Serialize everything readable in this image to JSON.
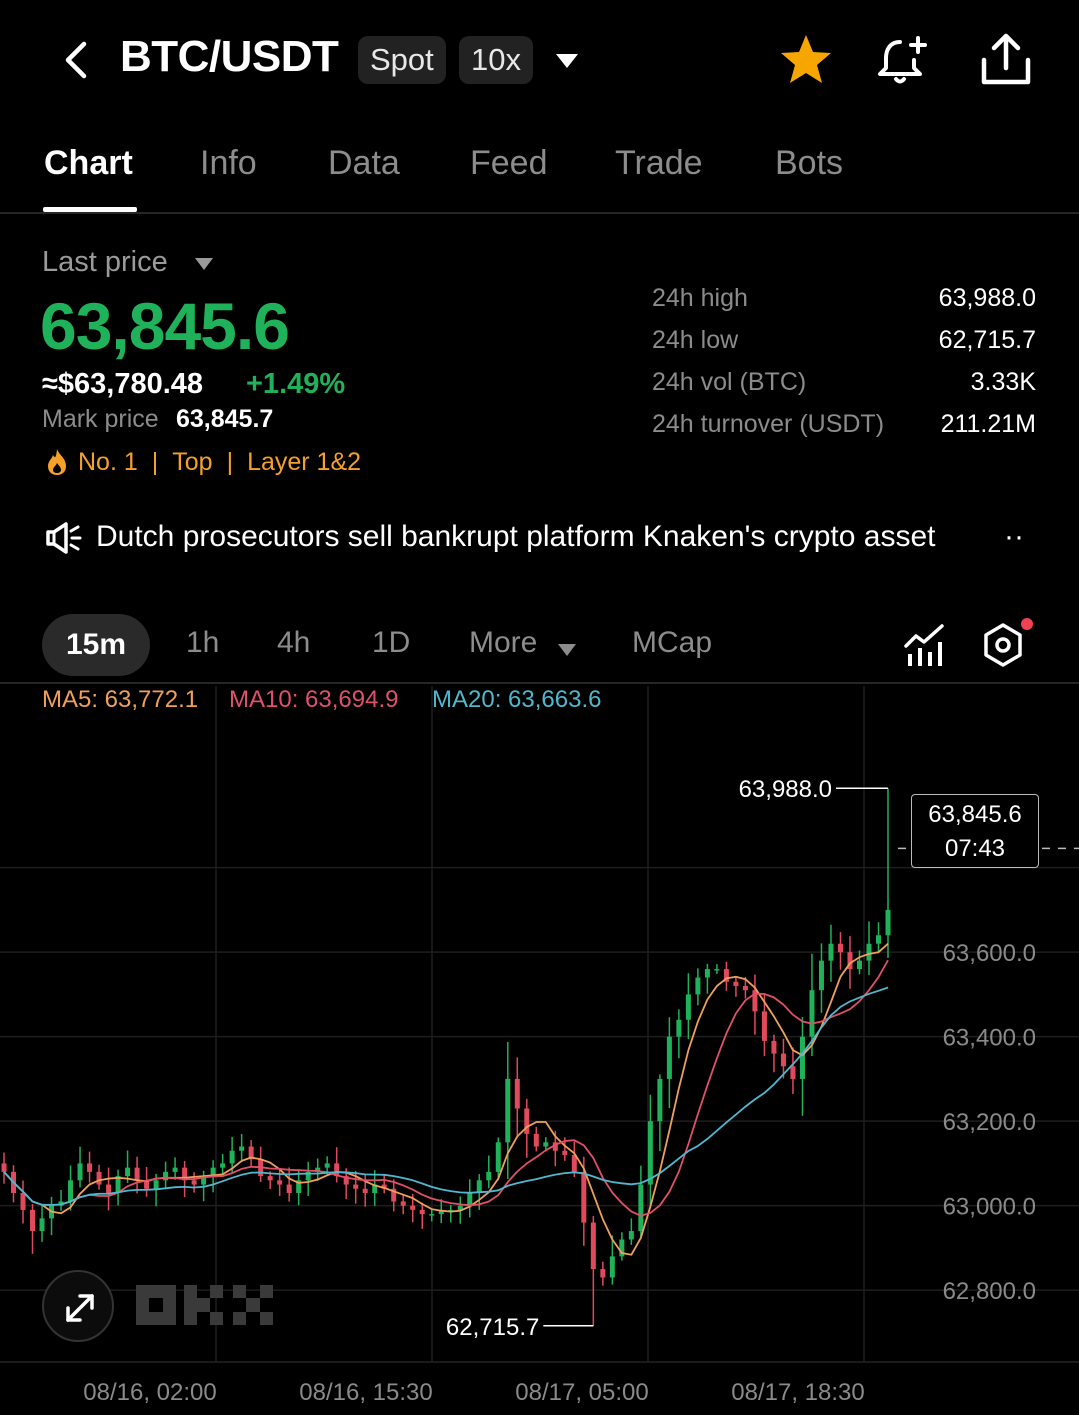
{
  "header": {
    "pair": "BTC/USDT",
    "market_chip": "Spot",
    "leverage_chip": "10x",
    "icons": [
      "back-arrow-icon",
      "chevron-down-icon",
      "star-icon",
      "bell-plus-icon",
      "share-icon"
    ]
  },
  "tabs": [
    "Chart",
    "Info",
    "Data",
    "Feed",
    "Trade",
    "Bots"
  ],
  "active_tab": "Chart",
  "price": {
    "label": "Last price",
    "last": "63,845.6",
    "usd_equiv": "≈$63,780.48",
    "change": "+1.49%",
    "mark_label": "Mark price",
    "mark_value": "63,845.7",
    "tags": [
      "No. 1",
      "Top",
      "Layer 1&2"
    ],
    "up_color": "#1fb25a",
    "tag_color": "#f5a02a"
  },
  "stats": [
    {
      "label": "24h high",
      "value": "63,988.0"
    },
    {
      "label": "24h low",
      "value": "62,715.7"
    },
    {
      "label": "24h vol (BTC)",
      "value": "3.33K"
    },
    {
      "label": "24h turnover (USDT)",
      "value": "211.21M"
    }
  ],
  "news": {
    "text": "Dutch prosecutors sell bankrupt platform Knaken's crypto asset",
    "more": "··"
  },
  "intervals": {
    "items": [
      "15m",
      "1h",
      "4h",
      "1D",
      "More",
      "MCap"
    ],
    "active": "15m"
  },
  "ma": {
    "ma5": "MA5: 63,772.1",
    "ma10": "MA10: 63,694.9",
    "ma20": "MA20: 63,663.6",
    "ma5_color": "#f0a05a",
    "ma10_color": "#e0506a",
    "ma20_color": "#4fb8cf"
  },
  "chart_data": {
    "type": "candlestick",
    "interval": "15m",
    "y_ticks": [
      63600.0,
      63400.0,
      63200.0,
      63000.0,
      62800.0
    ],
    "y_tick_labels": [
      "63,600.0",
      "63,400.0",
      "63,200.0",
      "63,000.0",
      "62,800.0"
    ],
    "x_tick_labels": [
      "08/16, 02:00",
      "08/16, 15:30",
      "08/17, 05:00",
      "08/17, 18:30"
    ],
    "ylim": [
      62630,
      64230
    ],
    "high_marker": {
      "label": "63,988.0",
      "value": 63988.0
    },
    "low_marker": {
      "label": "62,715.7",
      "value": 62715.7
    },
    "last_price": {
      "label": "63,845.6",
      "value": 63845.6,
      "countdown": "07:43",
      "ghost": "63,800.0"
    },
    "close_path": [
      63080,
      63030,
      62990,
      62940,
      62970,
      63000,
      63010,
      63060,
      63100,
      63080,
      63050,
      63030,
      63070,
      63090,
      63060,
      63040,
      63060,
      63080,
      63090,
      63060,
      63050,
      63070,
      63090,
      63100,
      63130,
      63140,
      63110,
      63070,
      63060,
      63050,
      63030,
      63060,
      63080,
      63090,
      63100,
      63070,
      63050,
      63040,
      63030,
      63050,
      63040,
      63010,
      63000,
      62990,
      62980,
      62980,
      62990,
      62990,
      63000,
      63030,
      63060,
      63080,
      63150,
      63300,
      63230,
      63170,
      63140,
      63150,
      63130,
      63120,
      63080,
      62960,
      62850,
      62830,
      62880,
      62920,
      62940,
      63050,
      63200,
      63300,
      63400,
      63440,
      63500,
      63540,
      63560,
      63560,
      63530,
      63520,
      63510,
      63460,
      63390,
      63360,
      63330,
      63300,
      63400,
      63510,
      63580,
      63620,
      63600,
      63560,
      63580,
      63620,
      63640,
      63700
    ],
    "ma_colors": [
      "#f0a05a",
      "#e0506a",
      "#4fb8cf"
    ],
    "up_color": "#1fb25a",
    "down_color": "#e04a5c"
  }
}
